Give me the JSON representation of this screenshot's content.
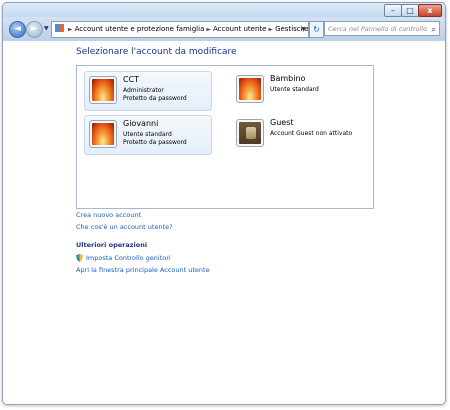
{
  "window": {
    "caption_buttons": {
      "minimize": "–",
      "maximize": "□",
      "close": "x"
    }
  },
  "navigation": {
    "back_glyph": "◄",
    "forward_glyph": "►",
    "breadcrumb": [
      "Account utente e protezione famiglia",
      "Account utente",
      "Gestisci account"
    ],
    "search_placeholder": "Cerca nel Pannello di controllo"
  },
  "main": {
    "heading": "Selezionare l'account da modificare",
    "accounts": [
      {
        "name": "CCT",
        "line1": "Administrator",
        "line2": "Protetto da password",
        "picture": "flower-icon"
      },
      {
        "name": "Bambino",
        "line1": "Utente standard",
        "line2": "",
        "picture": "flower-icon"
      },
      {
        "name": "Giovanni",
        "line1": "Utente standard",
        "line2": "Protetto da password",
        "picture": "flower-icon"
      },
      {
        "name": "Guest",
        "line1": "Account Guest non attivato",
        "line2": "",
        "picture": "guest-suitcase-icon"
      }
    ],
    "links": {
      "create_account": "Crea nuovo account",
      "what_is_account": "Che cos'è un account utente?"
    },
    "additional": {
      "title": "Ulteriori operazioni",
      "parental_controls": "Imposta Controllo genitori",
      "main_page": "Apri la finestra principale Account utente"
    }
  },
  "colors": {
    "heading": "#1e3287",
    "link": "#1a5fbc",
    "panel_border": "#a9b8cc"
  }
}
